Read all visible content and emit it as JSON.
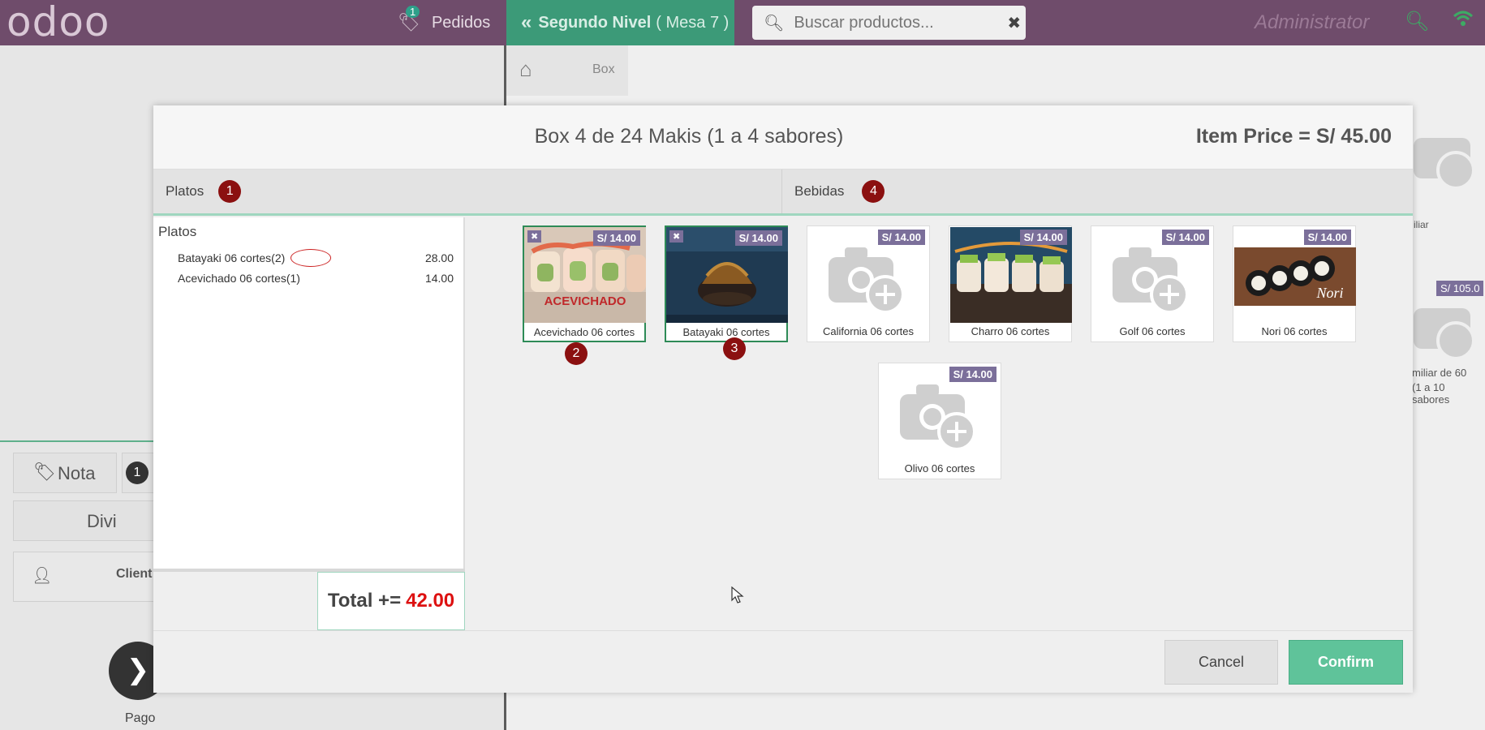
{
  "topbar": {
    "logo": "odoo",
    "orders_label": "Pedidos",
    "orders_count": "1",
    "table_label": "Segundo Nivel",
    "table_sub": "( Mesa 7 )",
    "search_placeholder": "Buscar productos...",
    "user": "Administrator"
  },
  "background": {
    "breadcrumb": "Box",
    "note_button": "Nota",
    "note_count": "1",
    "divide_button": "Divi",
    "client_label": "Client",
    "pay_label": "Pago",
    "right_price": "S/ 105.0",
    "right_card_label1": "iliar",
    "right_card_label2": "miliar de 60",
    "right_card_label3": "(1 a 10 sabores"
  },
  "modal": {
    "title": "Box 4 de 24 Makis (1 a 4 sabores)",
    "item_price": "Item Price = S/ 45.00",
    "tabs": [
      {
        "label": "Platos",
        "marker": "1"
      },
      {
        "label": "Bebidas",
        "marker": "4"
      }
    ],
    "summary": {
      "heading": "Platos",
      "lines": [
        {
          "name": "Batayaki 06 cortes(2)",
          "value": "28.00"
        },
        {
          "name": "Acevichado 06 cortes(1)",
          "value": "14.00"
        }
      ]
    },
    "total_label": "Total +=",
    "total_value": "42.00",
    "products": [
      {
        "name": "Acevichado 06 cortes",
        "price": "S/ 14.00",
        "selected": true,
        "marker": "2"
      },
      {
        "name": "Batayaki 06 cortes",
        "price": "S/ 14.00",
        "selected": true,
        "marker": "3"
      },
      {
        "name": "California 06 cortes",
        "price": "S/ 14.00",
        "selected": false
      },
      {
        "name": "Charro 06 cortes",
        "price": "S/ 14.00",
        "selected": false
      },
      {
        "name": "Golf 06 cortes",
        "price": "S/ 14.00",
        "selected": false
      },
      {
        "name": "Nori 06 cortes",
        "price": "S/ 14.00",
        "selected": false
      },
      {
        "name": "Olivo 06 cortes",
        "price": "S/ 14.00",
        "selected": false
      }
    ],
    "image_text": {
      "acevichado": "ACEVICHADO",
      "nori": "Nori"
    },
    "cancel_label": "Cancel",
    "confirm_label": "Confirm"
  },
  "colors": {
    "topbar": "#6f4c6b",
    "accent": "#5fc39a",
    "price_badge": "#7b6f9a",
    "marker": "#8b1010",
    "total_value": "#dd1111"
  }
}
